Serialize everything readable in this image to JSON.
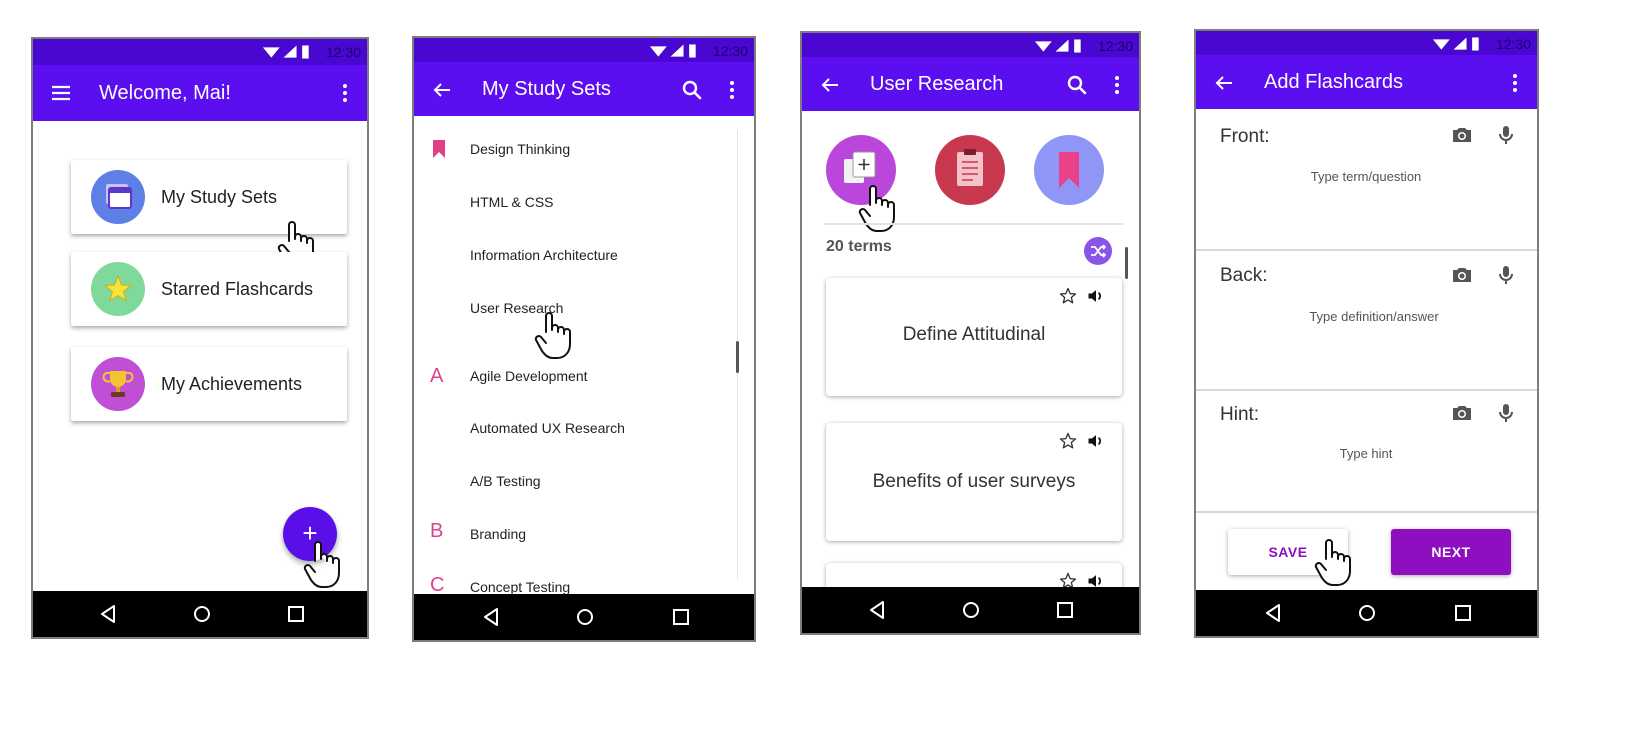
{
  "status": {
    "time": "12:30"
  },
  "screen_home": {
    "title": "Welcome, Mai!",
    "items": [
      {
        "label": "My Study Sets",
        "icon": "stacked-cards-icon"
      },
      {
        "label": "Starred Flashcards",
        "icon": "star-icon"
      },
      {
        "label": "My Achievements",
        "icon": "trophy-icon"
      }
    ],
    "fab_label": "+"
  },
  "screen_sets": {
    "title": "My Study Sets",
    "sections": [
      {
        "index": "",
        "icon": "bookmark-icon",
        "items": [
          "Design Thinking",
          "HTML & CSS",
          "Information Architecture",
          "User Research"
        ]
      },
      {
        "index": "A",
        "items": [
          "Agile Development",
          "Automated UX Research",
          "A/B Testing"
        ]
      },
      {
        "index": "B",
        "items": [
          "Branding"
        ]
      },
      {
        "index": "C",
        "items": [
          "Concept Testing"
        ]
      }
    ]
  },
  "screen_research": {
    "title": "User Research",
    "modes": [
      "add-card-icon",
      "clipboard-icon",
      "bookmark-icon"
    ],
    "term_count": "20 terms",
    "cards": [
      {
        "text": "Define Attitudinal"
      },
      {
        "text": "Benefits of user surveys"
      },
      {
        "text": ""
      }
    ]
  },
  "screen_add": {
    "title": "Add Flashcards",
    "fields": [
      {
        "label": "Front:",
        "placeholder": "Type term/question"
      },
      {
        "label": "Back:",
        "placeholder": "Type definition/answer"
      },
      {
        "label": "Hint:",
        "placeholder": "Type hint"
      }
    ],
    "save_label": "SAVE",
    "next_label": "NEXT"
  },
  "colors": {
    "statusbar": "#4a07d1",
    "appbar": "#5b0ef0",
    "accent_pink": "#e0408a",
    "next_button": "#8e0fbf",
    "save_text": "#8e0fbf"
  }
}
